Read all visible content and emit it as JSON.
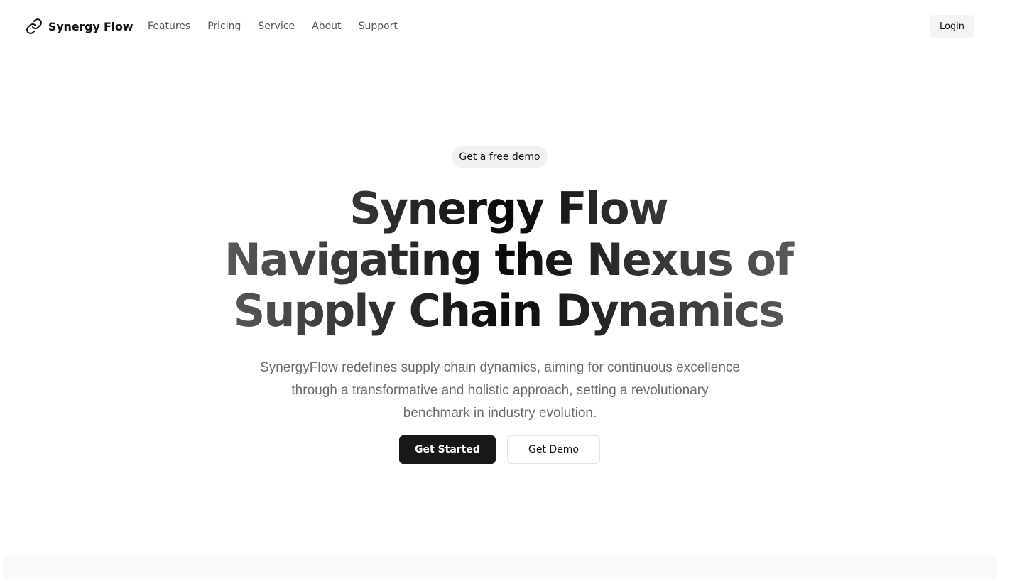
{
  "brand": {
    "name": "Synergy Flow",
    "icon": "link-icon"
  },
  "nav": {
    "items": [
      "Features",
      "Pricing",
      "Service",
      "About",
      "Support"
    ]
  },
  "header": {
    "login_label": "Login"
  },
  "hero": {
    "pill_label": "Get a free demo",
    "title_lines": [
      "Synergy Flow",
      "Navigating the Nexus of",
      "Supply Chain Dynamics"
    ],
    "subtitle": "SynergyFlow redefines supply chain dynamics, aiming for continuous excellence through a transformative and holistic approach, setting a revolutionary benchmark in industry evolution.",
    "primary_cta": "Get Started",
    "secondary_cta": "Get Demo"
  },
  "colors": {
    "primary_button": "#18181b",
    "muted_text": "#6b6b6e",
    "pill_bg": "#f1f1f2"
  }
}
